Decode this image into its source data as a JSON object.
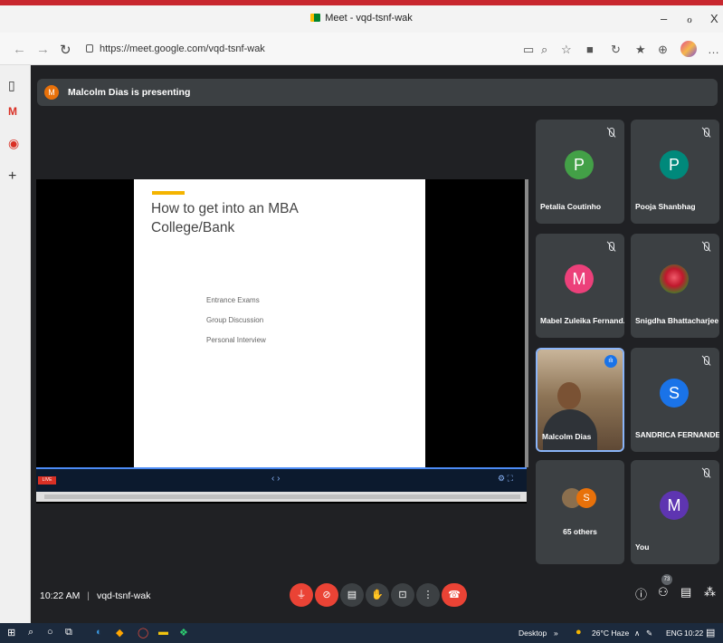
{
  "window": {
    "title": "Meet - vqd-tsnf-wak",
    "controls": {
      "minimize": "–",
      "maximize": "ℴ",
      "close": "X"
    }
  },
  "browser": {
    "url": "https://meet.google.com/vqd-tsnf-wak"
  },
  "banner": {
    "avatar_letter": "M",
    "text": "Malcolm Dias is presenting"
  },
  "slide": {
    "title": "How to get into an MBA College/Bank",
    "bullets": [
      "Entrance Exams",
      "Group Discussion",
      "Personal Interview"
    ],
    "live_badge": "LIVE",
    "nav_arrows": "‹ ›"
  },
  "participants": [
    {
      "name": "Petalia Coutinho",
      "letter": "P",
      "color": "#43a047",
      "muted": true
    },
    {
      "name": "Pooja Shanbhag",
      "letter": "P",
      "color": "#00897b",
      "muted": true
    },
    {
      "name": "Mabel Zuleika Fernand...",
      "letter": "M",
      "color": "#ec407a",
      "muted": true
    },
    {
      "name": "Snigdha Bhattacharjee",
      "letter": "",
      "color": "#c0182d",
      "muted": true
    },
    {
      "name": "Malcolm Dias",
      "letter": "",
      "color": "#000000",
      "muted": false
    },
    {
      "name": "SANDRICA FERNANDES",
      "letter": "S",
      "color": "#1a73e8",
      "muted": true
    },
    {
      "name": "65 others",
      "letter": "S",
      "color": "#e8710a",
      "muted": false
    },
    {
      "name": "You",
      "letter": "M",
      "color": "#5e35b1",
      "muted": true
    }
  ],
  "bottom": {
    "time": "10:22 AM",
    "separator": "|",
    "meeting_code": "vqd-tsnf-wak",
    "people_count": "73"
  },
  "taskbar": {
    "desktop_label": "Desktop",
    "weather": "26°C Haze",
    "lang": "ENG",
    "clock": "10:22"
  }
}
